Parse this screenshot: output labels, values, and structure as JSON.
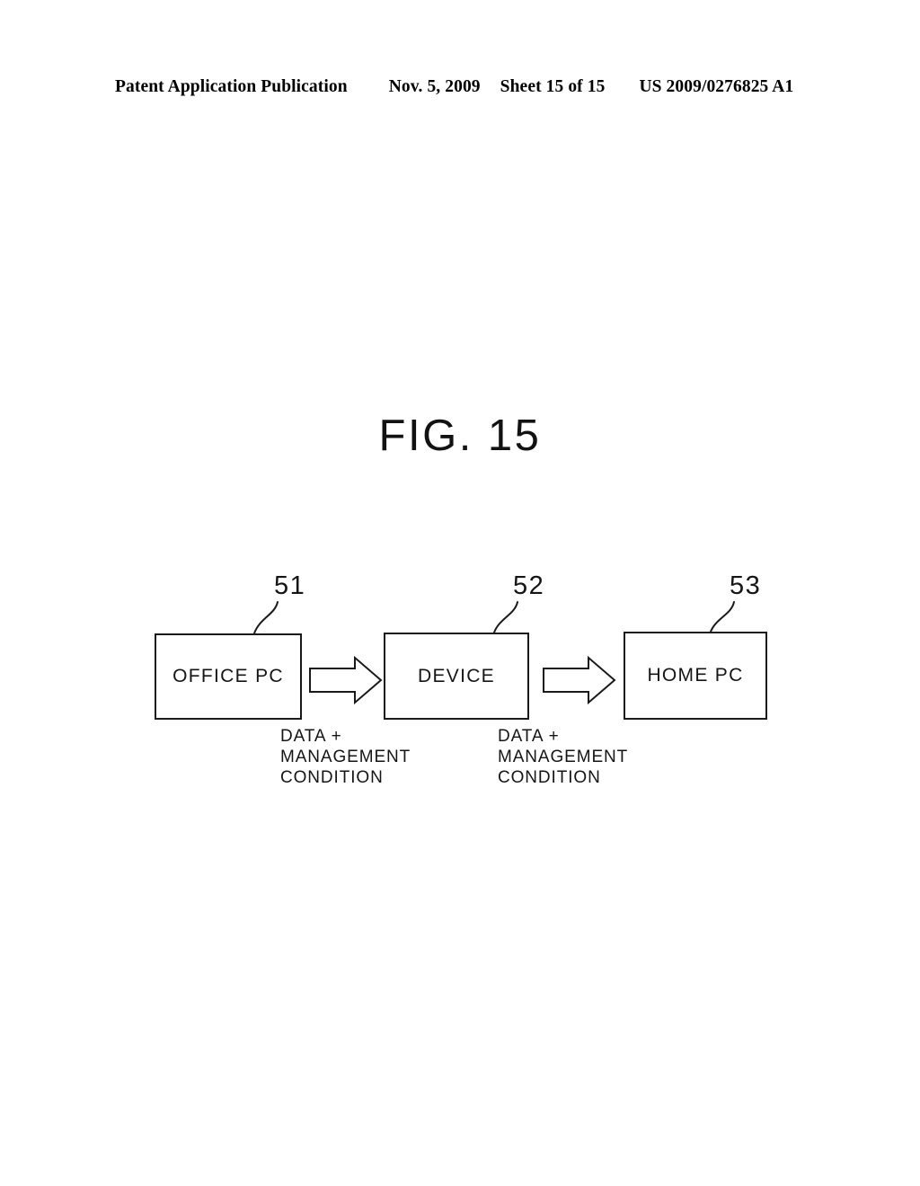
{
  "header": {
    "publication": "Patent Application Publication",
    "date": "Nov. 5, 2009",
    "sheet": "Sheet 15 of 15",
    "doc_number": "US 2009/0276825 A1"
  },
  "figure": {
    "title": "FIG. 15",
    "blocks": [
      {
        "id": "51",
        "label": "OFFICE PC"
      },
      {
        "id": "52",
        "label": "DEVICE"
      },
      {
        "id": "53",
        "label": "HOME PC"
      }
    ],
    "flows": [
      {
        "from": "51",
        "to": "52",
        "line1": "DATA +",
        "line2": "MANAGEMENT",
        "line3": "CONDITION"
      },
      {
        "from": "52",
        "to": "53",
        "line1": "DATA +",
        "line2": "MANAGEMENT",
        "line3": "CONDITION"
      }
    ],
    "colors": {
      "ink": "#151515",
      "paper": "#ffffff"
    }
  }
}
